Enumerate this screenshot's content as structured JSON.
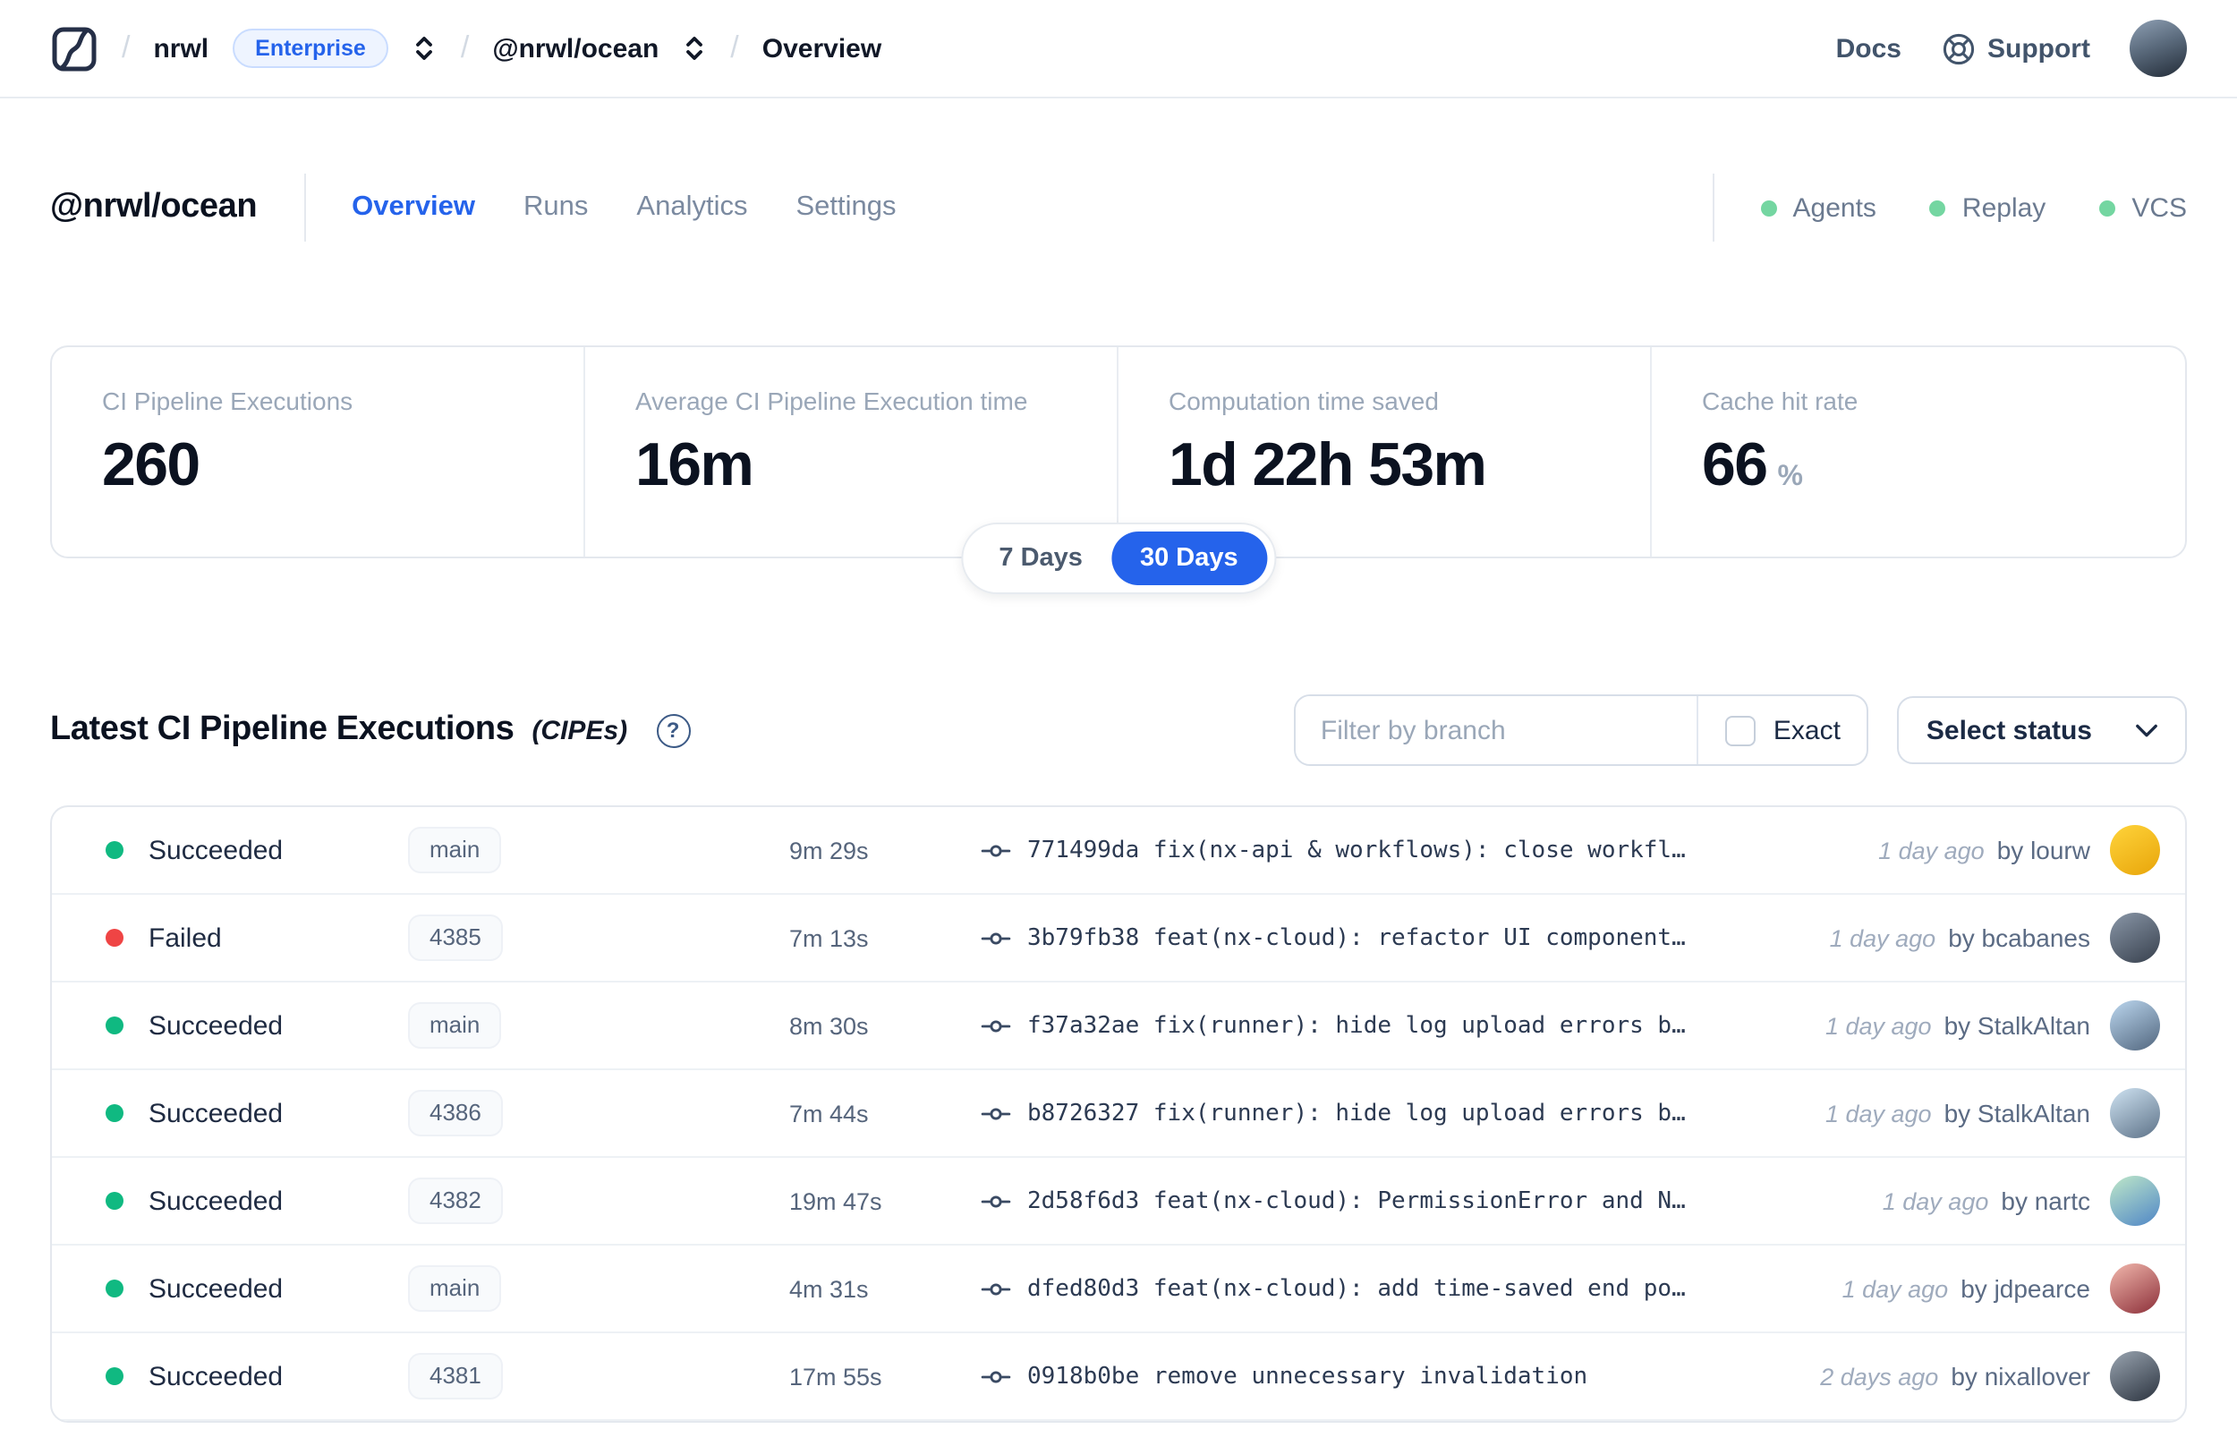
{
  "palette": {
    "accent": "#2563eb",
    "success": "#10b981",
    "danger": "#ef4444",
    "indicator_green": "#74d6a1"
  },
  "topbar": {
    "logo": "nx-cloud-logo",
    "breadcrumb": {
      "org": "nrwl",
      "org_badge": "Enterprise",
      "workspace": "@nrwl/ocean",
      "page": "Overview"
    },
    "docs_label": "Docs",
    "support_label": "Support"
  },
  "workspace_header": {
    "title": "@nrwl/ocean",
    "tabs": [
      {
        "label": "Overview",
        "active": true
      },
      {
        "label": "Runs",
        "active": false
      },
      {
        "label": "Analytics",
        "active": false
      },
      {
        "label": "Settings",
        "active": false
      }
    ],
    "indicators": [
      {
        "label": "Agents"
      },
      {
        "label": "Replay"
      },
      {
        "label": "VCS"
      }
    ]
  },
  "stats": {
    "cards": [
      {
        "label": "CI Pipeline Executions",
        "value": "260",
        "suffix": ""
      },
      {
        "label": "Average CI Pipeline Execution time",
        "value": "16m",
        "suffix": ""
      },
      {
        "label": "Computation time saved",
        "value": "1d 22h 53m",
        "suffix": ""
      },
      {
        "label": "Cache hit rate",
        "value": "66",
        "suffix": "%"
      }
    ],
    "range_toggle": {
      "options": [
        "7 Days",
        "30 Days"
      ],
      "selected": "30 Days"
    }
  },
  "cipe_section": {
    "title": "Latest CI Pipeline Executions",
    "title_suffix": "(CIPEs)",
    "filter": {
      "placeholder": "Filter by branch",
      "value": "",
      "exact_label": "Exact",
      "exact_checked": false
    },
    "status_select_label": "Select status",
    "rows": [
      {
        "status": "Succeeded",
        "kind": "success",
        "branch": "main",
        "duration": "9m 29s",
        "commit": "771499da",
        "message": "fix(nx-api & workflows): close workfl…",
        "time": "1 day ago",
        "author": "by lourw",
        "avatar": [
          "#ffd43b",
          "#e8a50a"
        ]
      },
      {
        "status": "Failed",
        "kind": "failed",
        "branch": "4385",
        "duration": "7m 13s",
        "commit": "3b79fb38",
        "message": "feat(nx-cloud): refactor UI component…",
        "time": "1 day ago",
        "author": "by bcabanes",
        "avatar": [
          "#8a97a8",
          "#37404d"
        ]
      },
      {
        "status": "Succeeded",
        "kind": "success",
        "branch": "main",
        "duration": "8m 30s",
        "commit": "f37a32ae",
        "message": "fix(runner): hide log upload errors b…",
        "time": "1 day ago",
        "author": "by StalkAltan",
        "avatar": [
          "#bcd7ef",
          "#51667e"
        ]
      },
      {
        "status": "Succeeded",
        "kind": "success",
        "branch": "4386",
        "duration": "7m 44s",
        "commit": "b8726327",
        "message": "fix(runner): hide log upload errors b…",
        "time": "1 day ago",
        "author": "by StalkAltan",
        "avatar": [
          "#cfe3f2",
          "#5d7288"
        ]
      },
      {
        "status": "Succeeded",
        "kind": "success",
        "branch": "4382",
        "duration": "19m 47s",
        "commit": "2d58f6d3",
        "message": "feat(nx-cloud): PermissionError and N…",
        "time": "1 day ago",
        "author": "by nartc",
        "avatar": [
          "#bfe8c9",
          "#4f86c6"
        ]
      },
      {
        "status": "Succeeded",
        "kind": "success",
        "branch": "main",
        "duration": "4m 31s",
        "commit": "dfed80d3",
        "message": "feat(nx-cloud): add time-saved end po…",
        "time": "1 day ago",
        "author": "by jdpearce",
        "avatar": [
          "#f2b8ad",
          "#8c2f39"
        ]
      },
      {
        "status": "Succeeded",
        "kind": "success",
        "branch": "4381",
        "duration": "17m 55s",
        "commit": "0918b0be",
        "message": "remove unnecessary invalidation",
        "time": "2 days ago",
        "author": "by nixallover",
        "avatar": [
          "#9aa5b1",
          "#2b333f"
        ]
      }
    ]
  }
}
